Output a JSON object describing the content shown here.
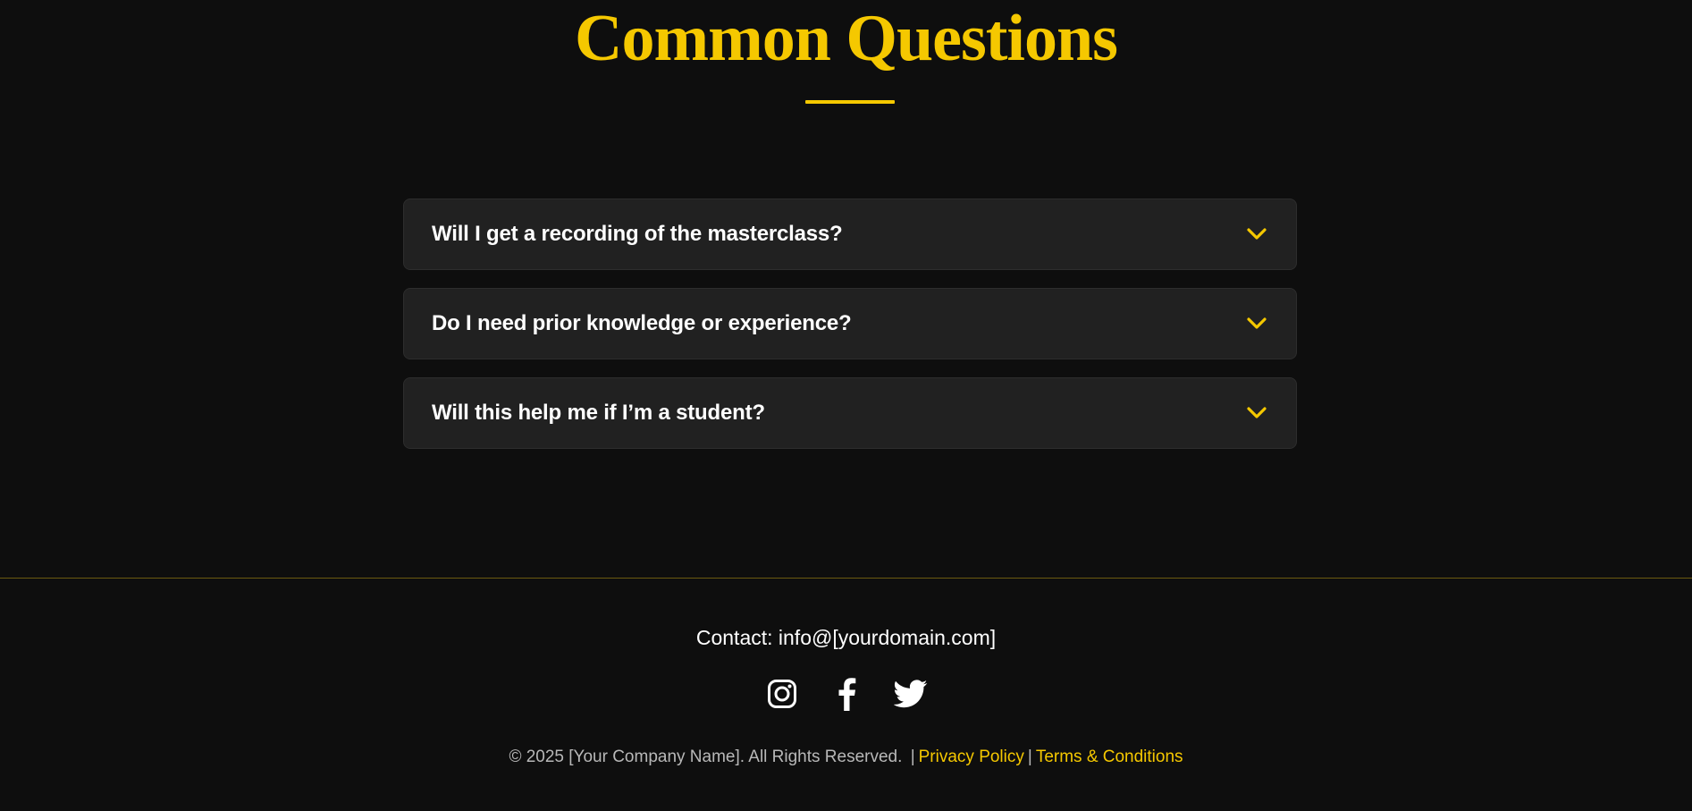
{
  "faq": {
    "title": "Common Questions",
    "items": [
      {
        "question": "Will I get a recording of the masterclass?"
      },
      {
        "question": "Do I need prior knowledge or experience?"
      },
      {
        "question": "Will this help me if I’m a student?"
      }
    ]
  },
  "footer": {
    "contact": "Contact: info@[yourdomain.com]",
    "social_icons": [
      "instagram-icon",
      "facebook-icon",
      "twitter-icon"
    ],
    "copyright": "© 2025 [Your Company Name]. All Rights Reserved.",
    "separator": "|",
    "privacy_link": "Privacy Policy",
    "terms_link": "Terms & Conditions"
  },
  "colors": {
    "background": "#0e0e0e",
    "accent": "#f5c800",
    "card": "#212121",
    "text": "#ffffff",
    "muted_text": "#b8b8b8"
  }
}
